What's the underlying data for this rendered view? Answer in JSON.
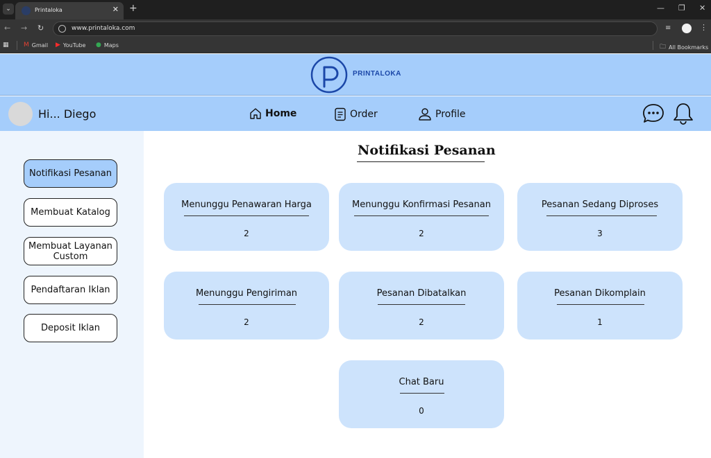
{
  "browser": {
    "tab_title": "Printaloka",
    "url": "www.printaloka.com",
    "bookmarks": [
      "Gmail",
      "YouTube",
      "Maps"
    ],
    "all_bookmarks": "All Bookmarks"
  },
  "brand": {
    "name": "PRINTALOKA",
    "accent": "#a5cdfb",
    "card_color": "#cde3fc",
    "logo_color": "#1b47a8"
  },
  "header": {
    "greeting": "Hi... Diego",
    "nav": [
      {
        "label": "Home",
        "icon": "home-icon",
        "active": true
      },
      {
        "label": "Order",
        "icon": "document-icon",
        "active": false
      },
      {
        "label": "Profile",
        "icon": "user-icon",
        "active": false
      }
    ]
  },
  "sidebar": {
    "items": [
      {
        "label": "Notifikasi Pesanan",
        "active": true
      },
      {
        "label": "Membuat Katalog",
        "active": false
      },
      {
        "label": "Membuat Layanan Custom",
        "active": false
      },
      {
        "label": "Pendaftaran Iklan",
        "active": false
      },
      {
        "label": "Deposit Iklan",
        "active": false
      }
    ]
  },
  "main": {
    "title": "Notifikasi Pesanan",
    "cards": [
      {
        "label": "Menunggu Penawaran Harga",
        "value": "2"
      },
      {
        "label": "Menunggu Konfirmasi Pesanan",
        "value": "2"
      },
      {
        "label": "Pesanan Sedang Diproses",
        "value": "3"
      },
      {
        "label": "Menunggu Pengiriman",
        "value": "2"
      },
      {
        "label": "Pesanan Dibatalkan",
        "value": "2"
      },
      {
        "label": "Pesanan Dikomplain",
        "value": "1"
      },
      {
        "label": "Chat Baru",
        "value": "0"
      }
    ]
  }
}
